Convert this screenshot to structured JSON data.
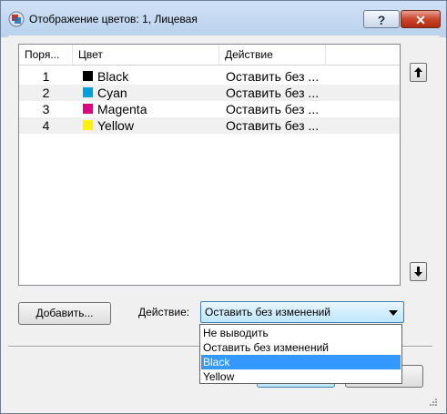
{
  "window": {
    "title": "Отображение цветов: 1, Лицевая",
    "help_label": "?",
    "close_label": "✕"
  },
  "list": {
    "columns": [
      "Поря...",
      "Цвет",
      "Действие"
    ],
    "rows": [
      {
        "order": "1",
        "color": "Black",
        "swatch": "#000000",
        "action": "Оставить без ..."
      },
      {
        "order": "2",
        "color": "Cyan",
        "swatch": "#00a0e0",
        "action": "Оставить без ..."
      },
      {
        "order": "3",
        "color": "Magenta",
        "swatch": "#e0007f",
        "action": "Оставить без ..."
      },
      {
        "order": "4",
        "color": "Yellow",
        "swatch": "#fff200",
        "action": "Оставить без ..."
      }
    ]
  },
  "controls": {
    "add_label": "Добавить...",
    "action_label": "Действие:",
    "action_value": "Оставить без изменений"
  },
  "dropdown": {
    "options": [
      "Не выводить",
      "Оставить без изменений",
      "Black",
      "Yellow"
    ],
    "selected": "Black"
  }
}
